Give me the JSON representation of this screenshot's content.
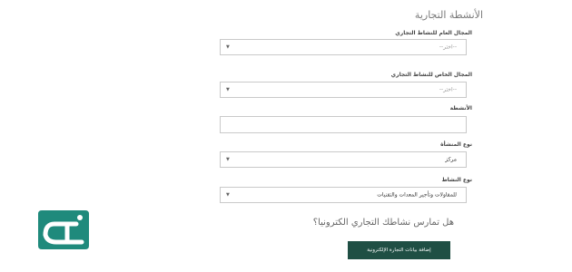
{
  "section_title": "الأنشطة التجارية",
  "fields": [
    {
      "label": "المجال العام للنشاط التجاري",
      "value": "--اختر--",
      "type": "select",
      "is_placeholder": true
    },
    {
      "label": "المجال الخاص للنشاط التجاري",
      "value": "--اختر--",
      "type": "select",
      "is_placeholder": true
    },
    {
      "label": "الأنشطة",
      "value": "",
      "type": "text",
      "is_placeholder": false
    },
    {
      "label": "نوع المنشأة",
      "value": "مركز",
      "type": "select",
      "is_placeholder": false
    },
    {
      "label": "نوع النشاط",
      "value": "للمقاولات وتأجير المعدات والتقنيات",
      "type": "select",
      "is_placeholder": false
    }
  ],
  "question": "هل تمارس نشاطك التجاري الكترونيا؟",
  "button_label": "إضافة بيانات التجارة الإلكترونية",
  "icons": {
    "dropdown": "caret-down-icon",
    "logo": "brand-logo"
  },
  "colors": {
    "button": "#1f4f44",
    "logo": "#1f8a7c",
    "field_border": "#c9c9c9"
  }
}
